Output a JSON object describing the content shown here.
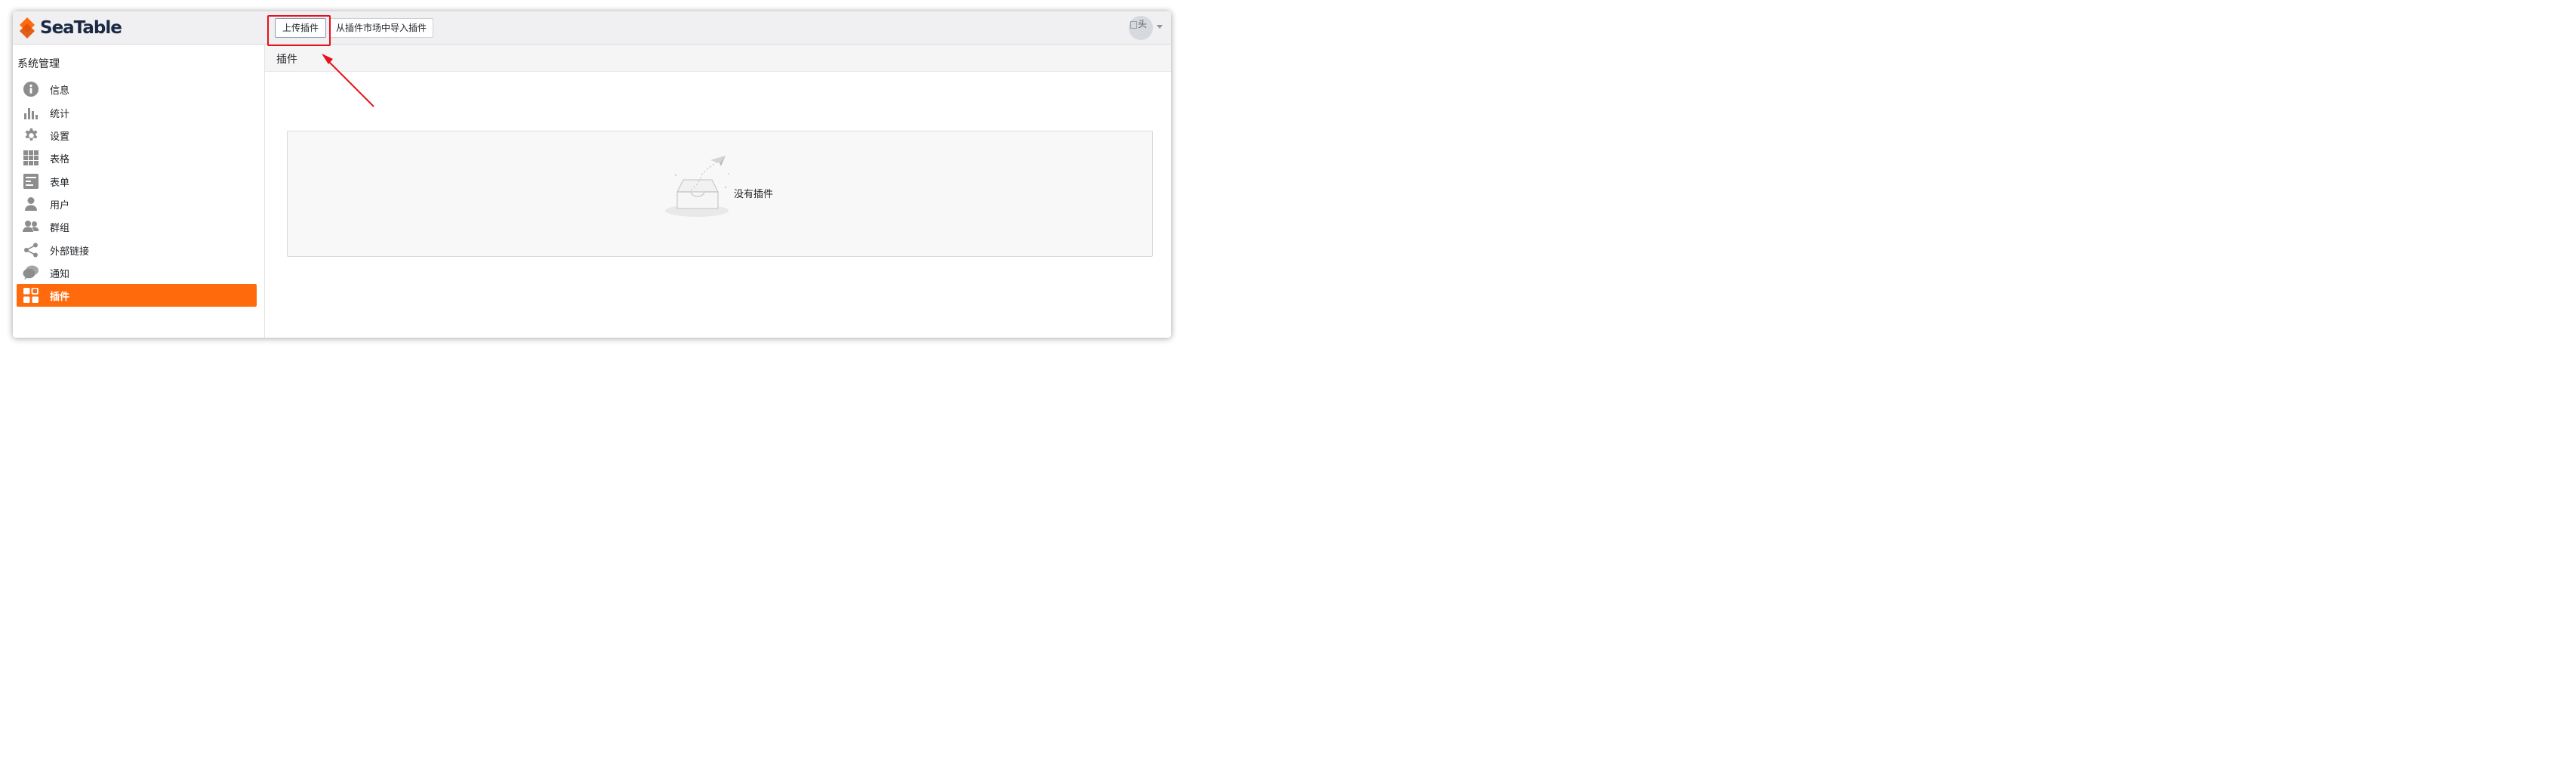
{
  "app": {
    "logo_text": "SeaTable",
    "brand_color": "#ff6a0d",
    "logo_mark_color": "#ff6a0d"
  },
  "header": {
    "upload_button": "上传插件",
    "market_button": "从插件市场中导入插件",
    "avatar_alt_1": "头",
    "avatar_alt_2": "像",
    "highlight_color": "#e8101a"
  },
  "sidebar": {
    "title": "系统管理",
    "items": [
      {
        "label": "信息",
        "icon": "info-icon",
        "active": false
      },
      {
        "label": "统计",
        "icon": "bar-chart-icon",
        "active": false
      },
      {
        "label": "设置",
        "icon": "gear-icon",
        "active": false
      },
      {
        "label": "表格",
        "icon": "grid-icon",
        "active": false
      },
      {
        "label": "表单",
        "icon": "form-icon",
        "active": false
      },
      {
        "label": "用户",
        "icon": "user-icon",
        "active": false
      },
      {
        "label": "群组",
        "icon": "group-icon",
        "active": false
      },
      {
        "label": "外部链接",
        "icon": "share-icon",
        "active": false
      },
      {
        "label": "通知",
        "icon": "chat-icon",
        "active": false
      },
      {
        "label": "插件",
        "icon": "plugin-icon",
        "active": true
      }
    ]
  },
  "main": {
    "section_title": "插件",
    "empty_text": "没有插件",
    "empty_icon": "empty-inbox-icon"
  }
}
